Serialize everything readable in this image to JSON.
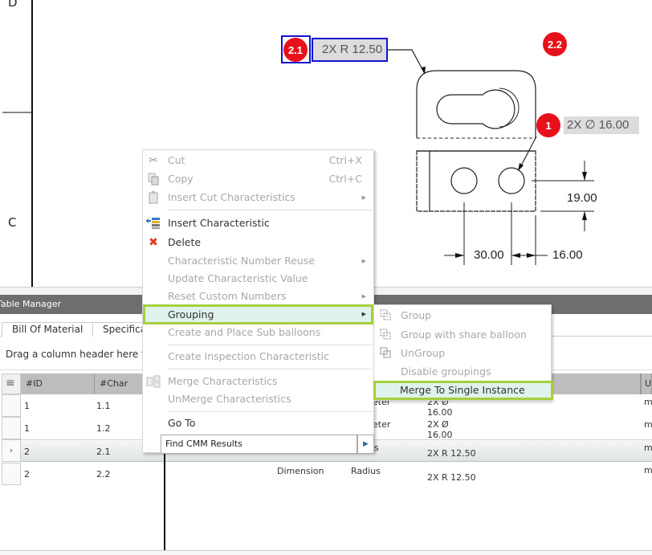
{
  "drawing": {
    "zone_letters": [
      "D",
      "C"
    ],
    "balloons": [
      {
        "id": "2.1",
        "selected": true
      },
      {
        "id": "2.2",
        "selected": false
      },
      {
        "id": "1",
        "selected": false
      }
    ],
    "callouts": {
      "balloon_2_1_tag": "2X R 12.50",
      "balloon_1_tag": "2X ∅ 16.00"
    },
    "dimensions": {
      "height": "19.00",
      "spacing": "30.00",
      "edge": "16.00"
    },
    "colors": {
      "balloon": "#e8101a",
      "selection": "#1414d0"
    }
  },
  "table_manager": {
    "title": "Table Manager",
    "tabs": [
      "Bill Of Material",
      "Specification"
    ],
    "group_hint": "Drag a column header here to group by that column",
    "columns": [
      "#ID",
      "#Char",
      "",
      "",
      "",
      "U"
    ],
    "rows": [
      {
        "id": "1",
        "char": "1.1",
        "type": "",
        "subtype": "Diameter",
        "value_l1": "2X Ø",
        "value_l2": "16.00",
        "unit": "m",
        "selected": false
      },
      {
        "id": "1",
        "char": "1.2",
        "type": "",
        "subtype": "Diameter",
        "value_l1": "2X Ø",
        "value_l2": "16.00",
        "unit": "m",
        "selected": false
      },
      {
        "id": "2",
        "char": "2.1",
        "type": "",
        "subtype": "Radius",
        "value_l1": "2X R 12.50",
        "value_l2": "",
        "unit": "m",
        "selected": true
      },
      {
        "id": "2",
        "char": "2.2",
        "type": "Dimension",
        "subtype": "Radius",
        "value_l1": "2X R 12.50",
        "value_l2": "",
        "unit": "m",
        "selected": false
      }
    ],
    "row_indicator": "›"
  },
  "context_menu": {
    "items": [
      {
        "label": "Cut",
        "shortcut": "Ctrl+X",
        "icon": "scissors-icon",
        "enabled": false
      },
      {
        "label": "Copy",
        "shortcut": "Ctrl+C",
        "icon": "copy-icon",
        "enabled": false
      },
      {
        "label": "Insert Cut Characteristics",
        "submenu": true,
        "icon": "paste-icon",
        "enabled": false
      },
      {
        "label": "Insert Characteristic",
        "icon": "insert-characteristic-icon",
        "enabled": true
      },
      {
        "label": "Delete",
        "icon": "delete-icon",
        "enabled": true
      },
      {
        "label": "Characteristic Number Reuse",
        "submenu": true,
        "enabled": false
      },
      {
        "label": "Update Characteristic Value",
        "enabled": false
      },
      {
        "label": "Reset Custom Numbers",
        "submenu": true,
        "enabled": false
      },
      {
        "label": "Grouping",
        "submenu": true,
        "enabled": true,
        "highlighted": true
      },
      {
        "label": "Create and Place Sub balloons",
        "enabled": false
      },
      {
        "label": "Create Inspection Characteristic",
        "enabled": false
      },
      {
        "label": "Merge Characteristics",
        "icon": "merge-icon",
        "enabled": false
      },
      {
        "label": "UnMerge Characteristics",
        "enabled": false
      },
      {
        "label": "Go To",
        "enabled": true
      }
    ],
    "find_cmm": {
      "label": "Find CMM Results",
      "arrow": "▶"
    },
    "submenu_arrow": "▶",
    "icons": {
      "cut": "✂",
      "delete": "✖"
    }
  },
  "grouping_submenu": {
    "items": [
      {
        "label": "Group",
        "icon": "group-icon",
        "enabled": false
      },
      {
        "label": "Group with share balloon",
        "icon": "group-share-icon",
        "enabled": false
      },
      {
        "label": "UnGroup",
        "icon": "ungroup-icon",
        "enabled": false
      },
      {
        "label": "Disable groupings",
        "enabled": false
      },
      {
        "label": "Merge To Single Instance",
        "enabled": true,
        "highlighted": true
      }
    ],
    "highlight_color": "#a6cf3c"
  }
}
